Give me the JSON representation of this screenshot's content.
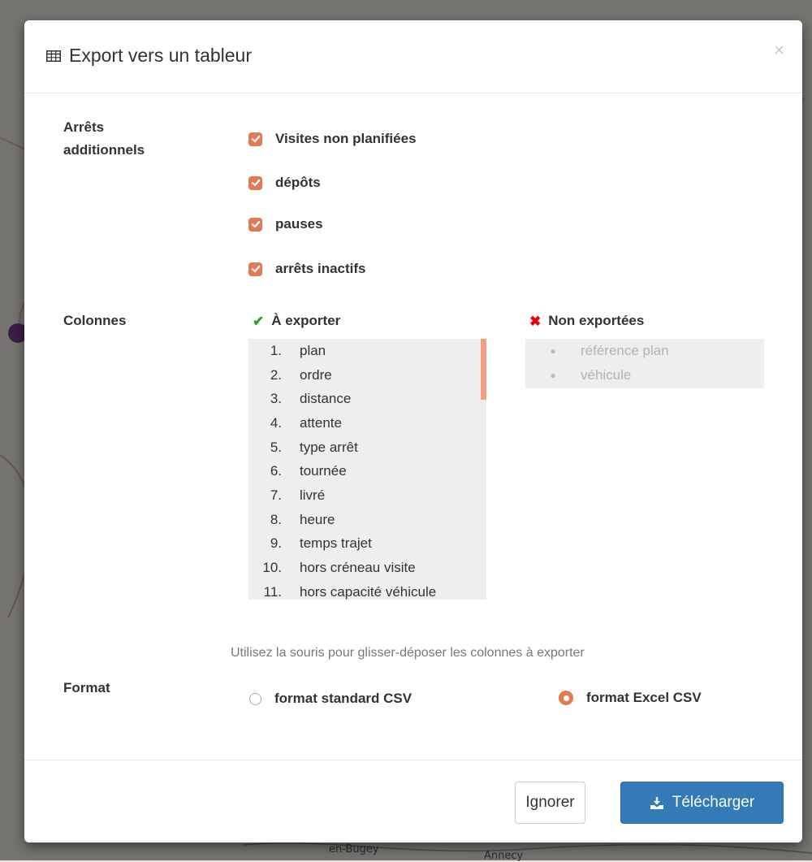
{
  "background_map": {
    "labels": [
      "en-Bugey",
      "Annecy"
    ]
  },
  "dialog": {
    "title": "Export vers un tableur",
    "title_icon": "table-icon",
    "close_label": "×"
  },
  "additional_stops": {
    "label": "Arrêts additionnels",
    "options": [
      {
        "label": "Visites non planifiées",
        "checked": true
      },
      {
        "label": "dépôts",
        "checked": true
      },
      {
        "label": "pauses",
        "checked": true
      },
      {
        "label": "arrêts inactifs",
        "checked": true
      }
    ]
  },
  "columns": {
    "label": "Colonnes",
    "to_export_heading": "À exporter",
    "not_exported_heading": "Non exportées",
    "to_export": [
      {
        "num": "1.",
        "label": "plan"
      },
      {
        "num": "2.",
        "label": "ordre"
      },
      {
        "num": "3.",
        "label": "distance"
      },
      {
        "num": "4.",
        "label": "attente"
      },
      {
        "num": "5.",
        "label": "type arrêt"
      },
      {
        "num": "6.",
        "label": "tournée"
      },
      {
        "num": "7.",
        "label": "livré"
      },
      {
        "num": "8.",
        "label": "heure"
      },
      {
        "num": "9.",
        "label": "temps trajet"
      },
      {
        "num": "10.",
        "label": "hors créneau visite"
      },
      {
        "num": "11.",
        "label": "hors capacité véhicule"
      }
    ],
    "not_exported": [
      {
        "label": "référence plan"
      },
      {
        "label": "véhicule"
      }
    ],
    "hint": "Utilisez la souris pour glisser-déposer les colonnes à exporter"
  },
  "format": {
    "label": "Format",
    "options": [
      {
        "label": "format standard CSV",
        "selected": false
      },
      {
        "label": "format Excel CSV",
        "selected": true
      }
    ]
  },
  "footer": {
    "ignore_label": "Ignorer",
    "download_label": "Télécharger"
  },
  "colors": {
    "accent": "#e07b53",
    "primary": "#337ab7",
    "check_green": "#2ca02c",
    "cross_red": "#e8000b"
  }
}
